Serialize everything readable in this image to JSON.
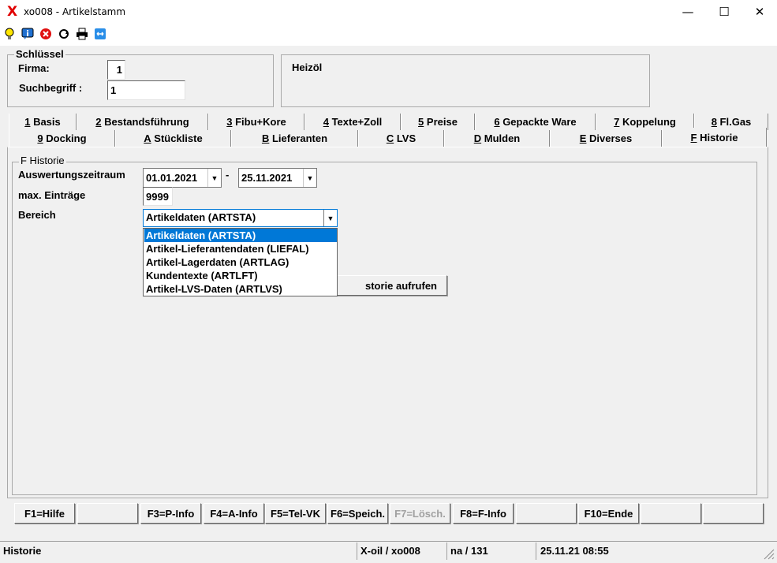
{
  "window": {
    "title": "xo008 - Artikelstamm",
    "logo": "X",
    "minimize": "—",
    "maximize": "☐",
    "close": "✕"
  },
  "toolbar": {
    "icons": [
      "lightbulb-icon",
      "info-icon",
      "cancel-icon",
      "refresh-icon",
      "print-icon",
      "swap-icon"
    ]
  },
  "key_group": {
    "title": "Schlüssel",
    "firma_label": "Firma:",
    "firma_value": "1",
    "suchbegriff_label": "Suchbegriff :",
    "suchbegriff_value": "1"
  },
  "description": "Heizöl",
  "tabs_row1": [
    {
      "key": "1",
      "label": " Basis"
    },
    {
      "key": "2",
      "label": " Bestandsführung"
    },
    {
      "key": "3",
      "label": " Fibu+Kore"
    },
    {
      "key": "4",
      "label": " Texte+Zoll"
    },
    {
      "key": "5",
      "label": " Preise"
    },
    {
      "key": "6",
      "label": " Gepackte Ware"
    },
    {
      "key": "7",
      "label": " Koppelung"
    },
    {
      "key": "8",
      "label": " Fl.Gas"
    }
  ],
  "tabs_row2": [
    {
      "key": "9",
      "label": " Docking"
    },
    {
      "key": "A",
      "label": " Stückliste"
    },
    {
      "key": "B",
      "label": " Lieferanten"
    },
    {
      "key": "C",
      "label": " LVS"
    },
    {
      "key": "D",
      "label": " Mulden"
    },
    {
      "key": "E",
      "label": " Diverses"
    },
    {
      "key": "F",
      "label": " Historie"
    }
  ],
  "historie": {
    "group_title": "F Historie",
    "zeitraum_label": "Auswertungszeitraum",
    "date_from": "01.01.2021",
    "date_sep": "-",
    "date_to": "25.11.2021",
    "max_label": "max. Einträge",
    "max_value": "9999",
    "bereich_label": "Bereich",
    "bereich_selected": "Artikeldaten (ARTSTA)",
    "bereich_options": [
      "Artikeldaten (ARTSTA)",
      "Artikel-Lieferantendaten (LIEFAL)",
      "Artikel-Lagerdaten (ARTLAG)",
      "Kundentexte (ARTLFT)",
      "Artikel-LVS-Daten (ARTLVS)"
    ],
    "call_button_partial": "storie aufrufen"
  },
  "fkeys": [
    "F1=Hilfe",
    "",
    "F3=P-Info",
    "F4=A-Info",
    "F5=Tel-VK",
    "F6=Speich.",
    "F7=Lösch.",
    "F8=F-Info",
    "",
    "F10=Ende",
    "",
    ""
  ],
  "status": {
    "mode": "Historie",
    "system": "X-oil / xo008",
    "user": "na / 131",
    "datetime": "25.11.21 08:55"
  }
}
